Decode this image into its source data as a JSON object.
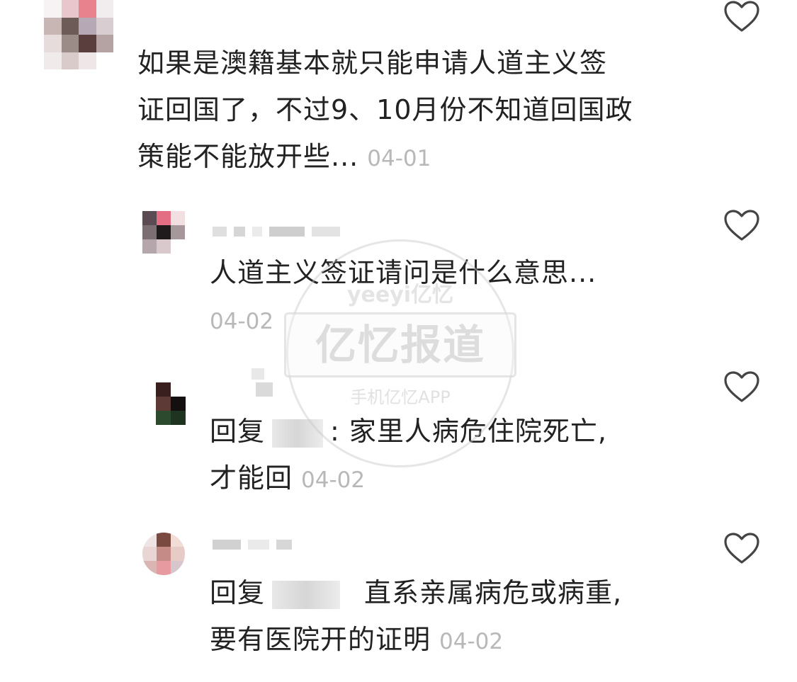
{
  "comments": [
    {
      "text_lines": [
        "如果是澳籍基本就只能申请人道主义签",
        "证回国了，不过9、10月份不知道回国政",
        "策能不能放开些..."
      ],
      "time": "04-01"
    },
    {
      "text_lines": [
        "人道主义签证请问是什么意思..."
      ],
      "time": "04-02"
    },
    {
      "reply_prefix": "回复",
      "reply_text": ": 家里人病危住院死亡,",
      "text_line2": "才能回",
      "time": "04-02"
    },
    {
      "reply_prefix": "回复",
      "reply_text": "直系亲属病危或病重,",
      "text_line2": "要有医院开的证明",
      "time": "04-02"
    }
  ],
  "watermark": {
    "top": "yeeyi亿忆",
    "main": "亿忆报道",
    "bottom": "手机亿忆APP"
  },
  "icons": {
    "like": "heart-outline-icon"
  },
  "colors": {
    "text": "#222222",
    "time": "#b8b8b8",
    "icon": "#444444"
  }
}
